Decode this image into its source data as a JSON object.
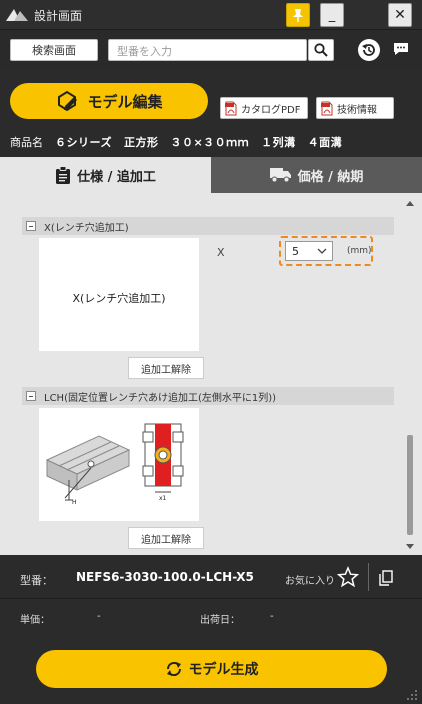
{
  "window": {
    "title": "設計画面",
    "min_symbol": "_",
    "close_symbol": "✕"
  },
  "search": {
    "screen_button": "検索画面",
    "placeholder": "型番を入力"
  },
  "header": {
    "model_edit_button": "モデル編集",
    "catalog_pdf_button": "カタログPDF",
    "tech_info_button": "技術情報",
    "product_name_label": "商品名",
    "product_series": "６シリーズ",
    "product_shape": "正方形",
    "product_size": "３０×３０ｍｍ",
    "product_rows": "１列溝",
    "product_faces": "４面溝"
  },
  "tabs": {
    "spec_label": "仕様 / 追加工",
    "price_label": "価格 / 納期"
  },
  "sections": {
    "x": {
      "title": "X(レンチ穴追加工)",
      "card_label": "X(レンチ穴追加工)",
      "param_label": "X",
      "value": "5",
      "unit": "(mm)",
      "remove_button": "追加工解除"
    },
    "lch": {
      "title": "LCH(固定位置レンチ穴あけ追加工(左側水平に1列))",
      "remove_button": "追加工解除",
      "dim_h": "H",
      "dim_x1": "x1"
    }
  },
  "footer": {
    "model_no_label": "型番：",
    "model_no_value": "NEFS6-3030-100.0-LCH-X5",
    "favorite_label": "お気に入り",
    "unit_price_label": "単価：",
    "unit_price_value": "-",
    "ship_date_label": "出荷日：",
    "ship_date_value": "-",
    "generate_button": "モデル生成"
  },
  "colors": {
    "accent_yellow": "#f9c300",
    "highlight_orange": "#f08a20",
    "dark_bg": "#2b2b2b",
    "content_bg": "#e6e6e6"
  }
}
